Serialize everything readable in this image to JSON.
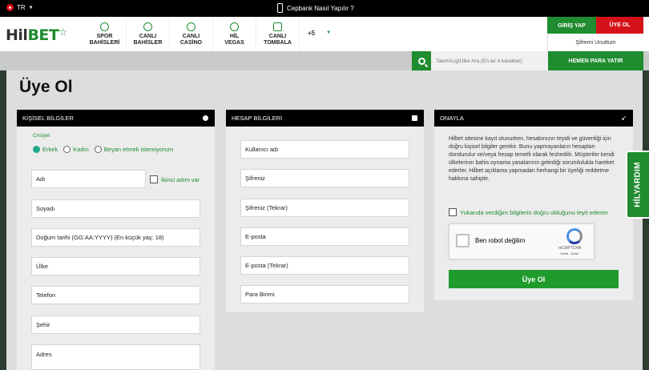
{
  "topbar": {
    "language": "TR",
    "app_link": "Cepbank Nasıl Yapılır ?"
  },
  "header": {
    "logo_hi": "Hil",
    "logo_bet": "BET",
    "nav": [
      {
        "line1": "SPOR",
        "line2": "BAHİSLERİ",
        "icon": "soccer-ball-icon"
      },
      {
        "line1": "CANLI",
        "line2": "BAHİSLER",
        "icon": "live-clock-icon"
      },
      {
        "line1": "CANLI",
        "line2": "CASİNO",
        "icon": "casino-chip-icon"
      },
      {
        "line1": "HİL",
        "line2": "VEGAS",
        "icon": "slot-icon"
      },
      {
        "line1": "CANLI",
        "line2": "TOMBALA",
        "icon": "tombala-grid-icon"
      }
    ],
    "more_label": "+5",
    "login": "GİRİŞ YAP",
    "register": "ÜYE OL",
    "forgot_password": "Şifremi Unuttum"
  },
  "search": {
    "placeholder": "Takım/Lig/Ülke Ara (En az 4 karakter)",
    "deposit": "HEMEN PARA YATIR"
  },
  "page": {
    "title": "Üye Ol"
  },
  "personal": {
    "heading": "KİŞİSEL BİLGİLER",
    "gender_label": "Cinsiyet",
    "gender_options": [
      "Erkek",
      "Kadın",
      "Beyan etmek istemiyorum"
    ],
    "gender_selected": "Erkek",
    "first_name": "Adı",
    "second_name_check": "İkinci adım var",
    "surname": "Soyadı",
    "birthdate": "Doğum tarihi (GG:AA:YYYY) (En küçük yaş: 18)",
    "country": "Ülke",
    "phone": "Telefon",
    "city": "Şehir",
    "address": "Adres"
  },
  "account": {
    "heading": "HESAP BİLGİLERİ",
    "username": "Kullanıcı adı",
    "password": "Şifreniz",
    "password_repeat": "Şifreniz (Tekrar)",
    "email": "E-posta",
    "email_repeat": "E-posta (Tekrar)",
    "currency": "Para Birimi"
  },
  "confirm": {
    "heading": "ONAYLA",
    "info": "Hilbet sitesine kayıt olunurken, hesabınızın teyidi ve güvenliği için doğru kişisel bilgiler gerekir. Bunu yapmayanların hesapları dondurulur ve/veya hesap temelli olarak feshedilir. Müşteriler kendi ülkelerinin bahis oynama yasalarının getirdiği sorumlulukla hareket ederler. Hilbet açıklama yapmadan herhangi bir üyeliği reddetme hakkına sahiptir.",
    "verify_label": "Yukarıda verdiğim bilgilerin doğru olduğunu teyit ederim",
    "captcha_text": "Ben robot değilim",
    "captcha_brand": "reCAPTCHA",
    "captcha_links": "Gizlilik - Şartlar",
    "submit": "Üye Ol"
  },
  "help_tab": "HİLYARDIM",
  "colors": {
    "brand_green": "#1f8c2f",
    "register_red": "#d4121a",
    "panel_head": "#000000"
  }
}
